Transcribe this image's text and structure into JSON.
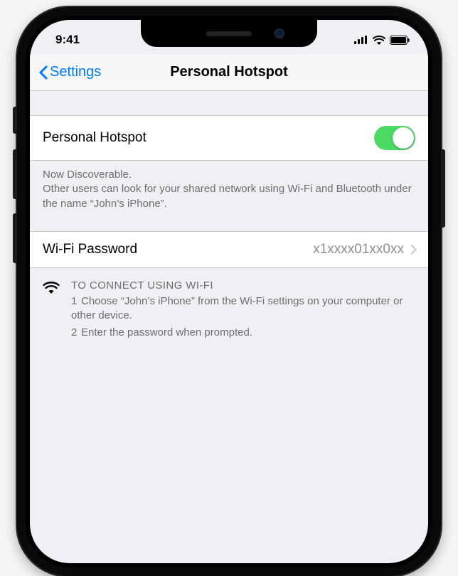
{
  "status": {
    "time": "9:41"
  },
  "nav": {
    "back_label": "Settings",
    "title": "Personal Hotspot"
  },
  "hotspot_toggle": {
    "label": "Personal Hotspot",
    "on": true
  },
  "discoverable": {
    "headline": "Now Discoverable.",
    "body": "Other users can look for your shared network using Wi-Fi and Bluetooth under the name “John’s iPhone”."
  },
  "wifi_password": {
    "label": "Wi-Fi Password",
    "value": "x1xxxx01xx0xx"
  },
  "instructions": {
    "title": "TO CONNECT USING WI-FI",
    "step1": "Choose “John’s iPhone” from the Wi-Fi settings on your computer or other device.",
    "step2": "Enter the password when prompted."
  }
}
